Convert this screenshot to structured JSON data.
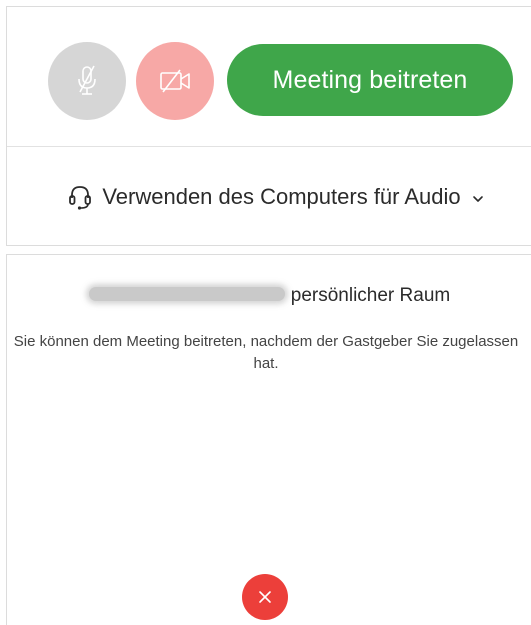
{
  "controls": {
    "join_label": "Meeting beitreten",
    "mic_state": "muted",
    "video_state": "off",
    "mic_icon": "microphone-muted-icon",
    "video_icon": "video-off-icon"
  },
  "audio": {
    "label": "Verwenden des Computers für Audio",
    "icon": "headset-icon",
    "dropdown_icon": "chevron-down-icon"
  },
  "room": {
    "title_suffix": "persönlicher Raum",
    "wait_message": "Sie können dem Meeting beitreten, nachdem der Gastgeber Sie zugelassen hat."
  },
  "leave": {
    "icon": "close-icon"
  },
  "colors": {
    "join_green": "#3fa64a",
    "video_off_pink": "#f7a8a6",
    "mic_grey": "#d6d6d6",
    "leave_red": "#ec3f3a"
  }
}
